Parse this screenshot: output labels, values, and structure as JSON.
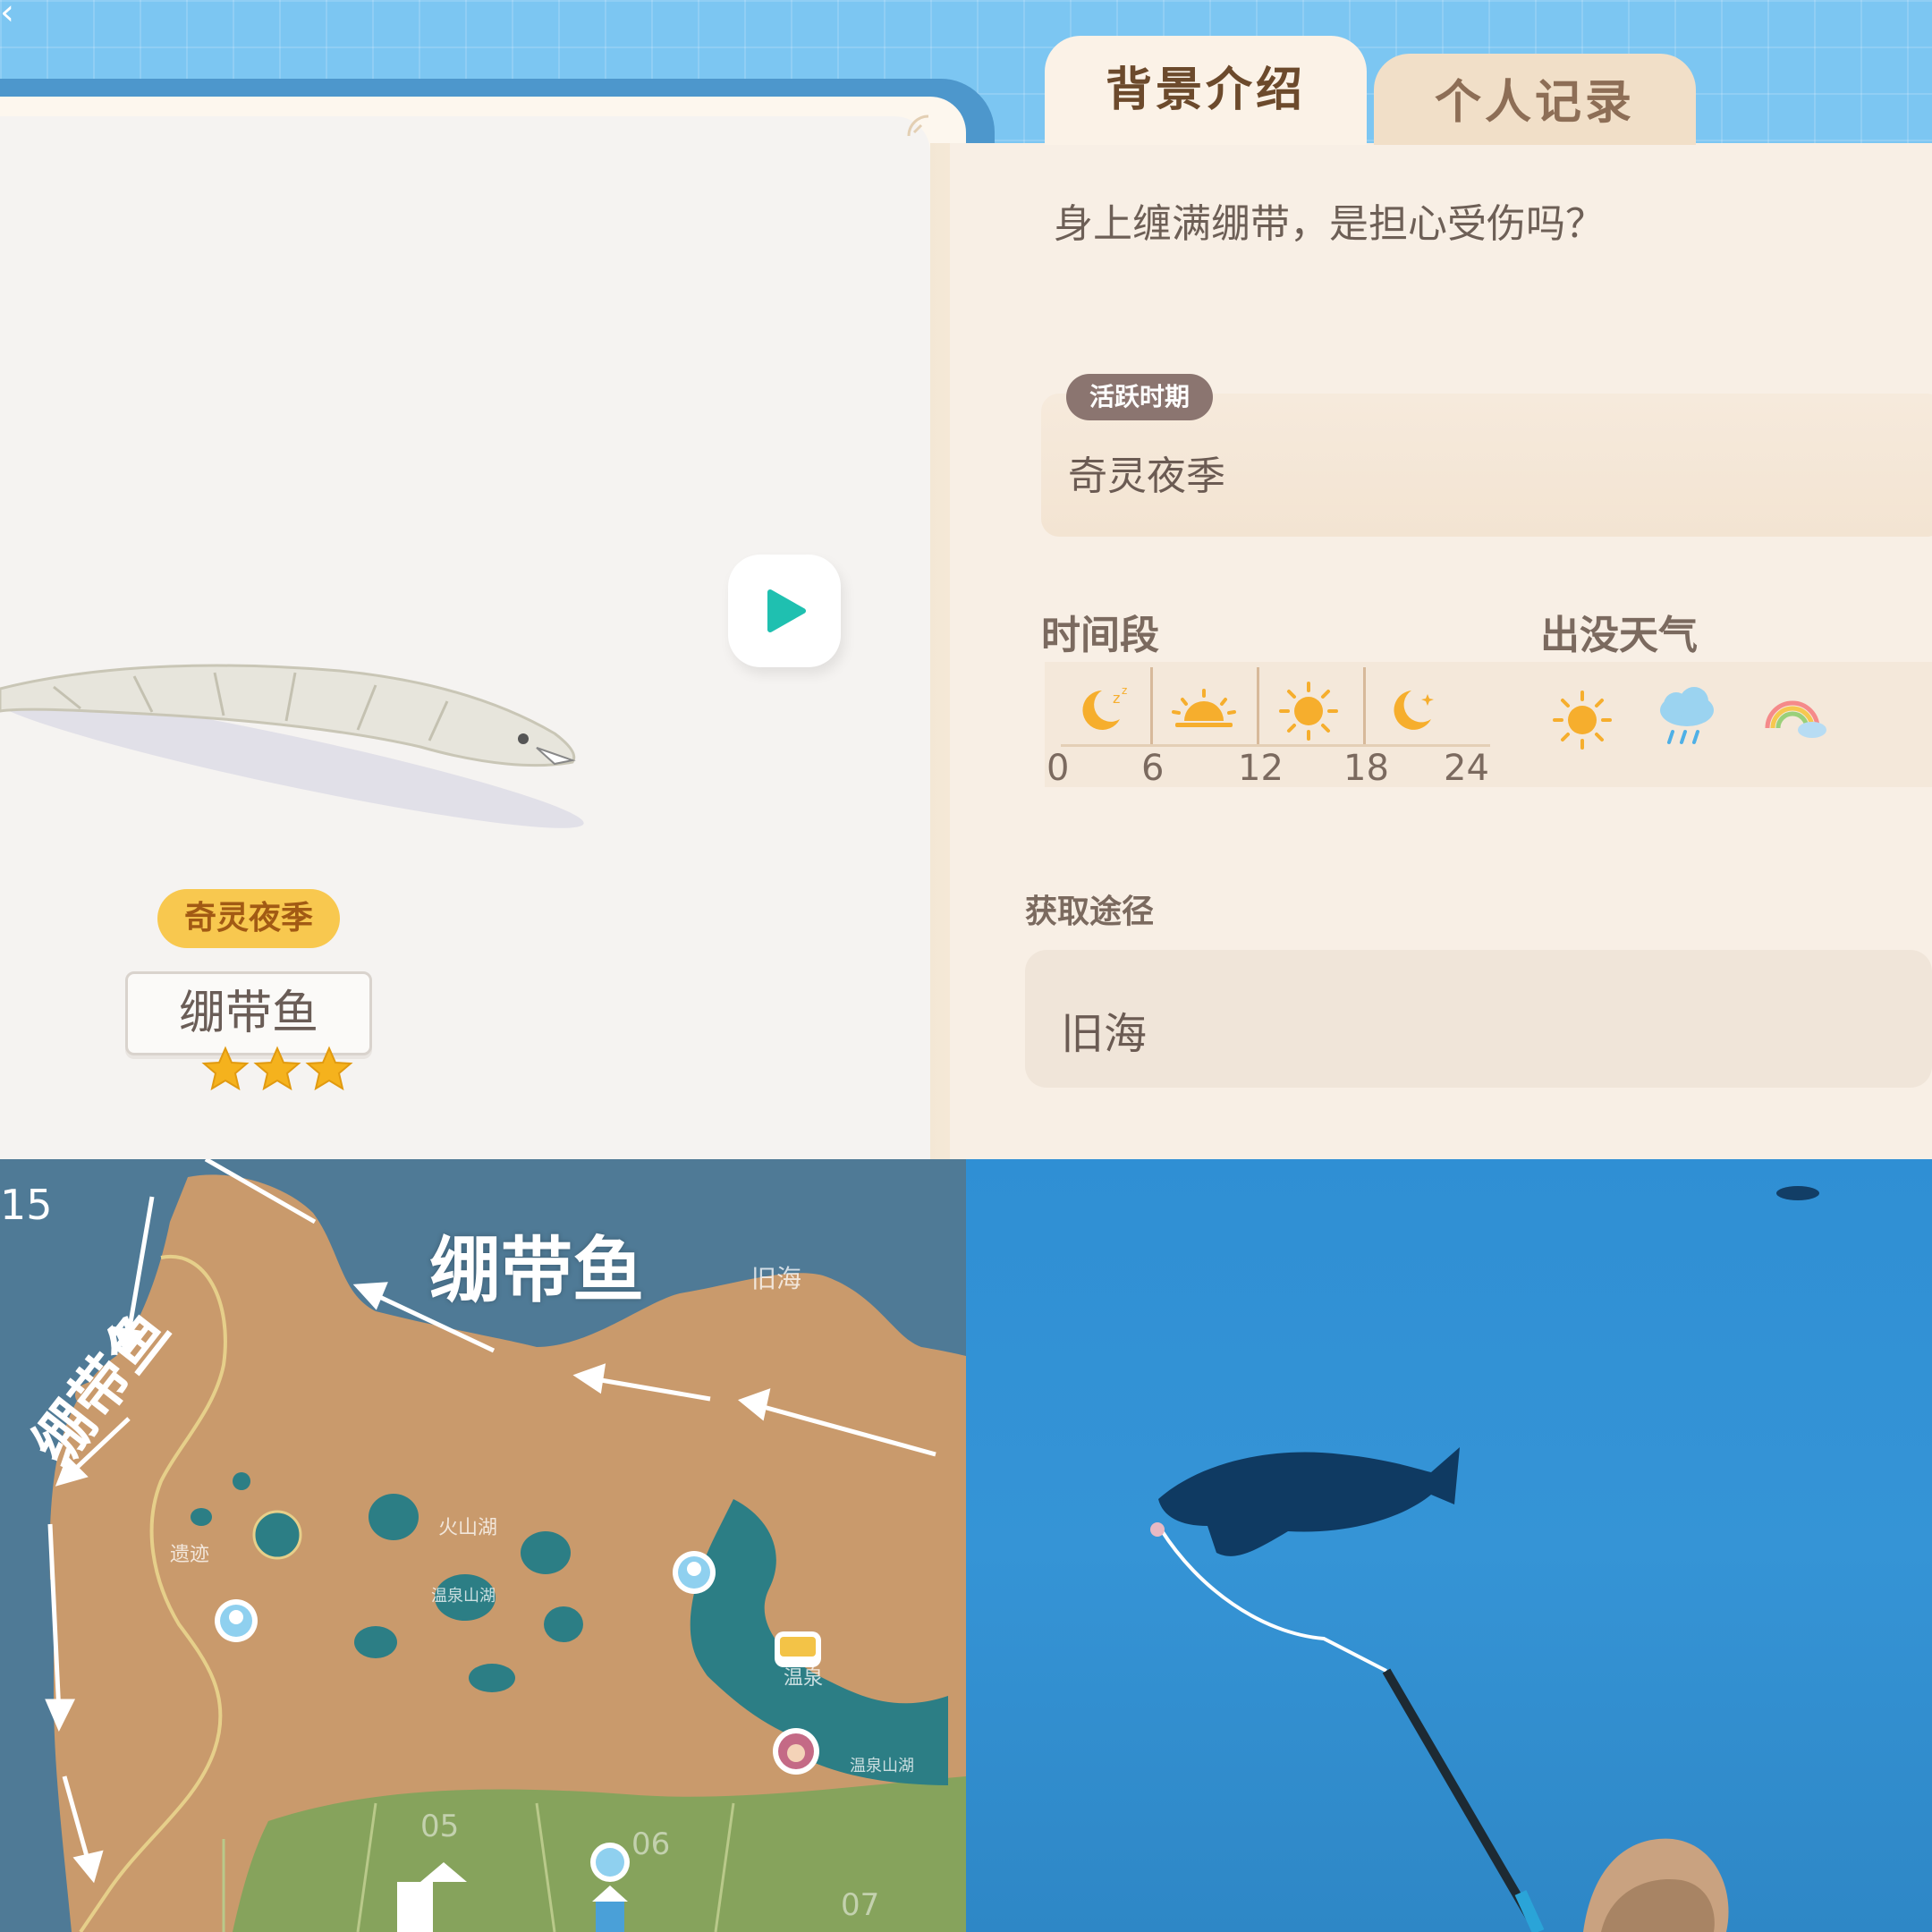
{
  "tabs": {
    "intro": "背景介绍",
    "record": "个人记录"
  },
  "fish": {
    "season_tag": "奇灵夜季",
    "name": "绷带鱼",
    "stars": 3,
    "description": "身上缠满绷带，是担心受伤吗？"
  },
  "active_period": {
    "label": "活跃时期",
    "value": "奇灵夜季"
  },
  "time_section": {
    "label": "时间段",
    "ticks": [
      "0",
      "6",
      "12",
      "18",
      "24"
    ],
    "icons": [
      "sleeping-moon-icon",
      "sunrise-icon",
      "sun-icon",
      "crescent-moon-icon"
    ]
  },
  "weather_section": {
    "label": "出没天气",
    "icons": [
      "sunny-weather-icon",
      "rainy-weather-icon",
      "rainbow-weather-icon"
    ]
  },
  "acquire": {
    "label": "获取途径",
    "value": "旧海"
  },
  "map": {
    "corner_number": "15",
    "annotation_main": "绷带鱼",
    "annotation_side": "绷带鱼",
    "area_old_sea": "旧海",
    "area_volcano_lake": "火山湖",
    "area_hot_spring_lake": "温泉山湖",
    "area_hot_spring_lake_2": "温泉山湖",
    "area_ruins": "遗迹",
    "area_hot_spring": "温泉",
    "zone_05": "05",
    "zone_06": "06",
    "zone_07": "07"
  },
  "colors": {
    "accent_blue": "#7cc6f2",
    "panel_bg": "#f8efe5",
    "tag_yellow": "#f8c84f",
    "play_teal": "#1fc0b0"
  }
}
